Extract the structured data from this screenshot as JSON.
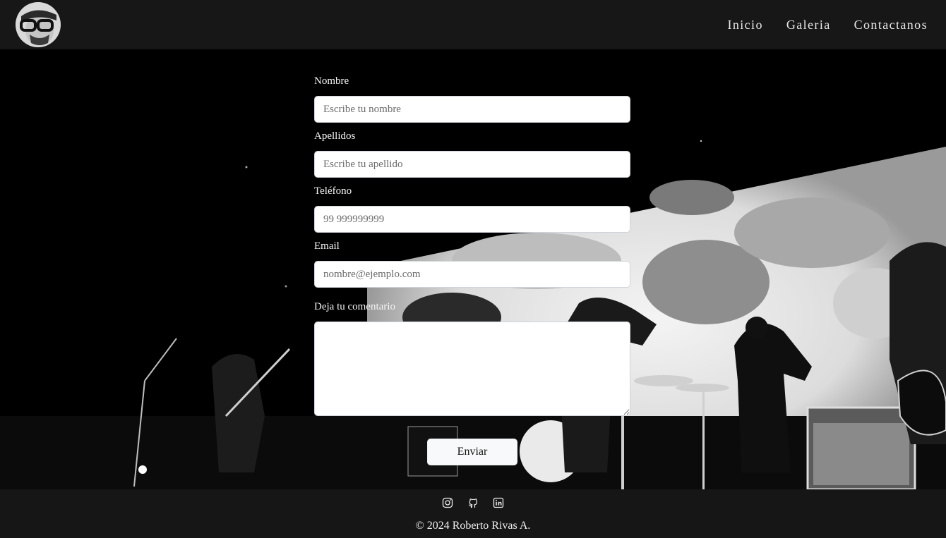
{
  "header": {
    "nav": [
      {
        "label": "Inicio"
      },
      {
        "label": "Galeria"
      },
      {
        "label": "Contactanos"
      }
    ]
  },
  "form": {
    "nombre": {
      "label": "Nombre",
      "placeholder": "Escribe tu nombre"
    },
    "apellidos": {
      "label": "Apellidos",
      "placeholder": "Escribe tu apellido"
    },
    "telefono": {
      "label": "Teléfono",
      "placeholder": "99 999999999"
    },
    "email": {
      "label": "Email",
      "placeholder": "nombre@ejemplo.com"
    },
    "comentario": {
      "label": "Deja tu comentario",
      "placeholder": ""
    },
    "submit_label": "Enviar"
  },
  "footer": {
    "icons": [
      "instagram-icon",
      "github-icon",
      "linkedin-icon"
    ],
    "copyright": "© 2024 Roberto Rivas A."
  },
  "colors": {
    "header_bg": "#171717",
    "footer_bg": "#161616",
    "nav_text": "#e8e8e8"
  }
}
